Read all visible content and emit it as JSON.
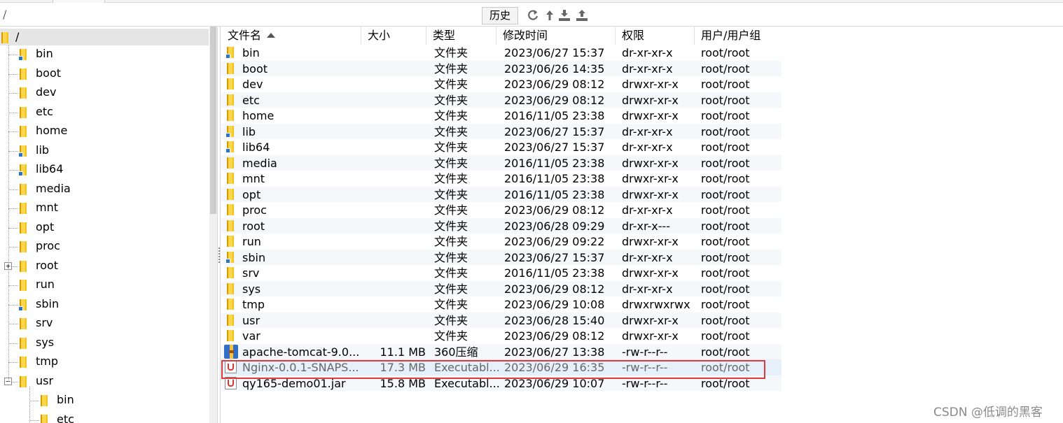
{
  "path_bar": {
    "path": "/",
    "history_label": "历史"
  },
  "toolbar_icons": [
    "refresh-icon",
    "up-arrow-icon",
    "download-icon",
    "upload-icon"
  ],
  "tree": {
    "root_label": "/",
    "items": [
      {
        "label": "bin",
        "link": true
      },
      {
        "label": "boot",
        "link": false
      },
      {
        "label": "dev",
        "link": false
      },
      {
        "label": "etc",
        "link": false
      },
      {
        "label": "home",
        "link": false
      },
      {
        "label": "lib",
        "link": true
      },
      {
        "label": "lib64",
        "link": true
      },
      {
        "label": "media",
        "link": false
      },
      {
        "label": "mnt",
        "link": false
      },
      {
        "label": "opt",
        "link": false
      },
      {
        "label": "proc",
        "link": false
      },
      {
        "label": "root",
        "link": false,
        "expandable": true
      },
      {
        "label": "run",
        "link": false
      },
      {
        "label": "sbin",
        "link": true
      },
      {
        "label": "srv",
        "link": false
      },
      {
        "label": "sys",
        "link": false
      },
      {
        "label": "tmp",
        "link": false
      },
      {
        "label": "usr",
        "link": false,
        "expanded": true
      }
    ],
    "usr_children": [
      "bin",
      "etc"
    ]
  },
  "file_list": {
    "headers": {
      "name": "文件名",
      "size": "大小",
      "type": "类型",
      "mtime": "修改时间",
      "perm": "权限",
      "owner": "用户/用户组"
    },
    "rows": [
      {
        "name": "bin",
        "size": "",
        "type": "文件夹",
        "mtime": "2023/06/27 15:37",
        "perm": "dr-xr-xr-x",
        "owner": "root/root",
        "icon": "folder-link"
      },
      {
        "name": "boot",
        "size": "",
        "type": "文件夹",
        "mtime": "2023/06/26 14:35",
        "perm": "dr-xr-xr-x",
        "owner": "root/root",
        "icon": "folder"
      },
      {
        "name": "dev",
        "size": "",
        "type": "文件夹",
        "mtime": "2023/06/29 08:12",
        "perm": "drwxr-xr-x",
        "owner": "root/root",
        "icon": "folder"
      },
      {
        "name": "etc",
        "size": "",
        "type": "文件夹",
        "mtime": "2023/06/29 08:12",
        "perm": "drwxr-xr-x",
        "owner": "root/root",
        "icon": "folder"
      },
      {
        "name": "home",
        "size": "",
        "type": "文件夹",
        "mtime": "2016/11/05 23:38",
        "perm": "drwxr-xr-x",
        "owner": "root/root",
        "icon": "folder"
      },
      {
        "name": "lib",
        "size": "",
        "type": "文件夹",
        "mtime": "2023/06/27 15:37",
        "perm": "dr-xr-xr-x",
        "owner": "root/root",
        "icon": "folder-link"
      },
      {
        "name": "lib64",
        "size": "",
        "type": "文件夹",
        "mtime": "2023/06/27 15:37",
        "perm": "dr-xr-xr-x",
        "owner": "root/root",
        "icon": "folder-link"
      },
      {
        "name": "media",
        "size": "",
        "type": "文件夹",
        "mtime": "2016/11/05 23:38",
        "perm": "drwxr-xr-x",
        "owner": "root/root",
        "icon": "folder"
      },
      {
        "name": "mnt",
        "size": "",
        "type": "文件夹",
        "mtime": "2016/11/05 23:38",
        "perm": "drwxr-xr-x",
        "owner": "root/root",
        "icon": "folder"
      },
      {
        "name": "opt",
        "size": "",
        "type": "文件夹",
        "mtime": "2016/11/05 23:38",
        "perm": "drwxr-xr-x",
        "owner": "root/root",
        "icon": "folder"
      },
      {
        "name": "proc",
        "size": "",
        "type": "文件夹",
        "mtime": "2023/06/29 08:12",
        "perm": "dr-xr-xr-x",
        "owner": "root/root",
        "icon": "folder"
      },
      {
        "name": "root",
        "size": "",
        "type": "文件夹",
        "mtime": "2023/06/28 09:29",
        "perm": "dr-xr-x---",
        "owner": "root/root",
        "icon": "folder"
      },
      {
        "name": "run",
        "size": "",
        "type": "文件夹",
        "mtime": "2023/06/29 09:22",
        "perm": "drwxr-xr-x",
        "owner": "root/root",
        "icon": "folder"
      },
      {
        "name": "sbin",
        "size": "",
        "type": "文件夹",
        "mtime": "2023/06/27 15:37",
        "perm": "dr-xr-xr-x",
        "owner": "root/root",
        "icon": "folder-link"
      },
      {
        "name": "srv",
        "size": "",
        "type": "文件夹",
        "mtime": "2016/11/05 23:38",
        "perm": "drwxr-xr-x",
        "owner": "root/root",
        "icon": "folder"
      },
      {
        "name": "sys",
        "size": "",
        "type": "文件夹",
        "mtime": "2023/06/29 08:12",
        "perm": "dr-xr-xr-x",
        "owner": "root/root",
        "icon": "folder"
      },
      {
        "name": "tmp",
        "size": "",
        "type": "文件夹",
        "mtime": "2023/06/29 10:08",
        "perm": "drwxrwxrwx",
        "owner": "root/root",
        "icon": "folder"
      },
      {
        "name": "usr",
        "size": "",
        "type": "文件夹",
        "mtime": "2023/06/28 15:40",
        "perm": "drwxr-xr-x",
        "owner": "root/root",
        "icon": "folder"
      },
      {
        "name": "var",
        "size": "",
        "type": "文件夹",
        "mtime": "2023/06/29 08:12",
        "perm": "drwxr-xr-x",
        "owner": "root/root",
        "icon": "folder"
      },
      {
        "name": "apache-tomcat-9.0....",
        "size": "11.1 MB",
        "type": "360压缩",
        "mtime": "2023/06/27 13:38",
        "perm": "-rw-r--r--",
        "owner": "root/root",
        "icon": "archive"
      },
      {
        "name": "Nginx-0.0.1-SNAPS...",
        "size": "17.3 MB",
        "type": "Executabl...",
        "mtime": "2023/06/29 16:35",
        "perm": "-rw-r--r--",
        "owner": "root/root",
        "icon": "java-jar",
        "selected": true
      },
      {
        "name": "qy165-demo01.jar",
        "size": "15.8 MB",
        "type": "Executabl...",
        "mtime": "2023/06/29 10:07",
        "perm": "-rw-r--r--",
        "owner": "root/root",
        "icon": "java-jar"
      }
    ]
  },
  "colors": {
    "folder": "#f2c21c",
    "link_badge": "#2a74c8",
    "selection": "#e5f0fa",
    "highlight_box": "#e03b3b"
  },
  "watermark": "CSDN @低调的黑客"
}
